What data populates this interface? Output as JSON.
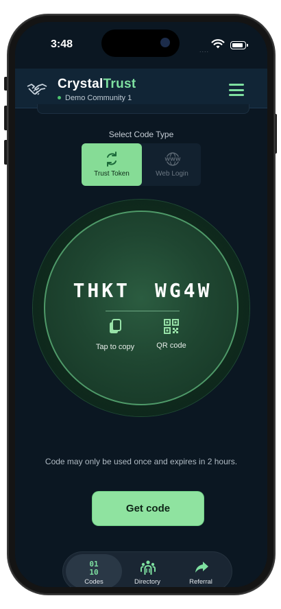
{
  "status_bar": {
    "time": "3:48",
    "signal": "...."
  },
  "header": {
    "brand_part1": "Crystal",
    "brand_part2": "Trust",
    "community": "Demo Community 1"
  },
  "code_type": {
    "label": "Select Code Type",
    "options": [
      {
        "label": "Trust Token",
        "icon": "swap-arrows-icon",
        "selected": true
      },
      {
        "label": "Web Login",
        "icon": "globe-www-icon",
        "selected": false
      }
    ]
  },
  "code": {
    "part1": "THKT",
    "part2": "WG4W",
    "copy_label": "Tap to copy",
    "qr_label": "QR code"
  },
  "notice": "Code may only be used once and expires in 2 hours.",
  "get_code_label": "Get code",
  "nav": {
    "items": [
      {
        "label": "Codes",
        "icon": "binary-code-icon",
        "active": true
      },
      {
        "label": "Directory",
        "icon": "people-group-icon",
        "active": false
      },
      {
        "label": "Referral",
        "icon": "share-arrow-icon",
        "active": false
      }
    ]
  },
  "colors": {
    "accent": "#86dc96",
    "background": "#0b1722",
    "header": "#112536"
  }
}
